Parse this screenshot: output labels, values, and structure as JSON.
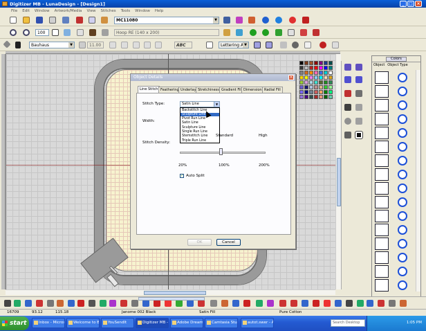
{
  "window": {
    "title": "Digitizer MB - LunaDesign - [Design1]",
    "controls": [
      "_",
      "□",
      "×"
    ]
  },
  "menubar": [
    "File",
    "Edit",
    "Window",
    "Artwork/Media",
    "View",
    "Stitches",
    "Tools",
    "Window",
    "Help"
  ],
  "toolbar1": {
    "design_name": "MC11080"
  },
  "toolbar2": {
    "zoom": "100",
    "hoop": "Hoop RE (140 x 200)"
  },
  "toolbar3": {
    "font": "Bauhaus",
    "font_size": "11.00",
    "sample": "ABC",
    "lettering": "Lettering Art"
  },
  "dialog": {
    "title": "Object Details",
    "tabs": [
      "Line Stitch",
      "Feathering",
      "Underlay",
      "Stretchiness",
      "Gradient Fill",
      "Dimensions",
      "Radial Fill"
    ],
    "stitch_type_label": "Stitch Type:",
    "stitch_type_value": "Satin Line",
    "stitch_options": [
      "Backstitch Line",
      "Sculpture Line",
      "Pivot Run Line",
      "Satin Line",
      "Sculpture Line",
      "Single Run Line",
      "Stemstitch Line",
      "Triple Run Line"
    ],
    "highlighted_index": 1,
    "width_label": "Width:",
    "density_label": "Stitch Density:",
    "density_scale_top": [
      "Standard",
      "High"
    ],
    "density_scale_bottom": [
      "20%",
      "100%",
      "200%"
    ],
    "auto_split_label": "Auto Split",
    "ok_label": "OK",
    "cancel_label": "Cancel"
  },
  "right_panel": {
    "colors_button": "Colors",
    "col_object": "Object",
    "col_object_type": "Object Type",
    "row_count": 16
  },
  "statusbar": {
    "stitches": "16709",
    "x": "93.12",
    "y": "115.18",
    "thread": "Janome 002 Black",
    "type": "Satin Fill",
    "material": "Pure Cotton"
  },
  "taskbar": {
    "start": "start",
    "tasks": [
      "Inbox - Micros...",
      "Welcome to B...",
      "YouSendIt",
      "Digitizer MB -...",
      "Adobe Dreamw...",
      "Camtasia Stud...",
      "autot.swer - A..."
    ],
    "active_index": 3,
    "search": "Search Desktop",
    "clock": "1:05 PM"
  },
  "colors": {
    "accent": "#316ac5",
    "titlebar": "#0a5fd8",
    "hoop_fabric": "#f7f3cf",
    "hoop_frame": "#9a9a9a",
    "object_type_icon": "#1b4fd8"
  },
  "palette_swatches": [
    "#000000",
    "#7a3b1c",
    "#a0522d",
    "#8b0000",
    "#800080",
    "#1e3a8a",
    "#004d4d",
    "#3a3a3a",
    "#c0c0c0",
    "#b22222",
    "#ff0000",
    "#ff00ff",
    "#0000ff",
    "#008080",
    "#808080",
    "#d2691e",
    "#ff8c00",
    "#ff69b4",
    "#4169e1",
    "#00ced1",
    "#ffffff",
    "#ffd700",
    "#ffff00",
    "#ee82ee",
    "#87cefa",
    "#00ffff",
    "#f5deb3",
    "#daa520",
    "#9acd32",
    "#dda0dd",
    "#add8e6",
    "#40e0d0",
    "#556b2f",
    "#228b22",
    "#2e8b57",
    "#6a5acd",
    "#191970",
    "#b0c4de",
    "#bc8f8f",
    "#deb887",
    "#32cd32",
    "#98fb98",
    "#7b68ee",
    "#000080",
    "#708090",
    "#cd5c5c",
    "#f4a460",
    "#008000",
    "#00ff7f",
    "#9370db",
    "#4b0082",
    "#2f4f4f",
    "#a52a2a",
    "#e9967a",
    "#006400",
    "#66cdaa"
  ]
}
